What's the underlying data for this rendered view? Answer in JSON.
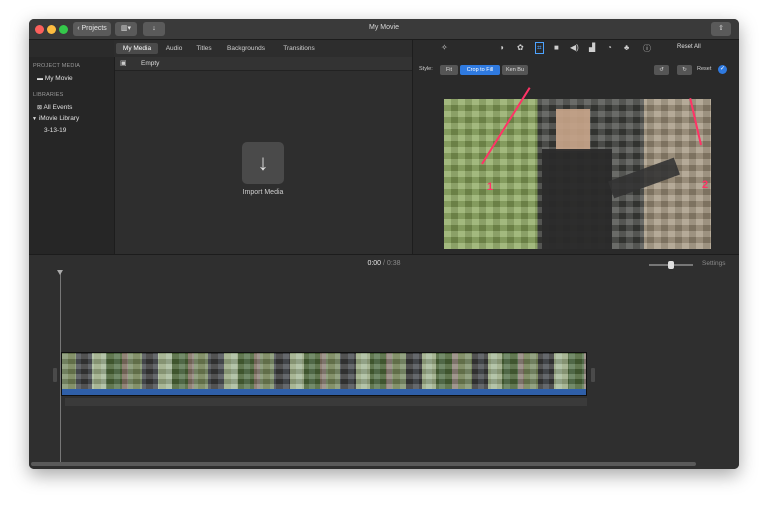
{
  "titlebar": {
    "title": "My Movie",
    "projects_label": "Projects",
    "back_icon": "chevron-left-icon",
    "layout_icon": "view-layout-icon",
    "import_icon": "download-arrow-icon",
    "share_icon": "share-icon"
  },
  "browser_tabs": [
    "My Media",
    "Audio",
    "Titles",
    "Backgrounds",
    "Transitions"
  ],
  "sidebar": {
    "project_media_header": "PROJECT MEDIA",
    "project_item": "My Movie",
    "libraries_header": "LIBRARIES",
    "all_events": "All Events",
    "library_name": "iMovie Library",
    "event_date": "3-13-19"
  },
  "browser": {
    "filter_label": "Empty",
    "import_label": "Import Media"
  },
  "viewer": {
    "reset_all_label": "Reset All",
    "style_label": "Style:",
    "style_options": [
      "Fit",
      "Crop to Fill",
      "Ken Bu"
    ],
    "selected_style": "Crop to Fill",
    "reset_label": "Reset",
    "annotation_1": "1",
    "annotation_2": "2",
    "annotation_color": "#ff3366",
    "accent_color": "#2f7ae0"
  },
  "timeline": {
    "current_time": "0:00",
    "separator": "/",
    "total_time": "0:38",
    "settings_label": "Settings"
  }
}
